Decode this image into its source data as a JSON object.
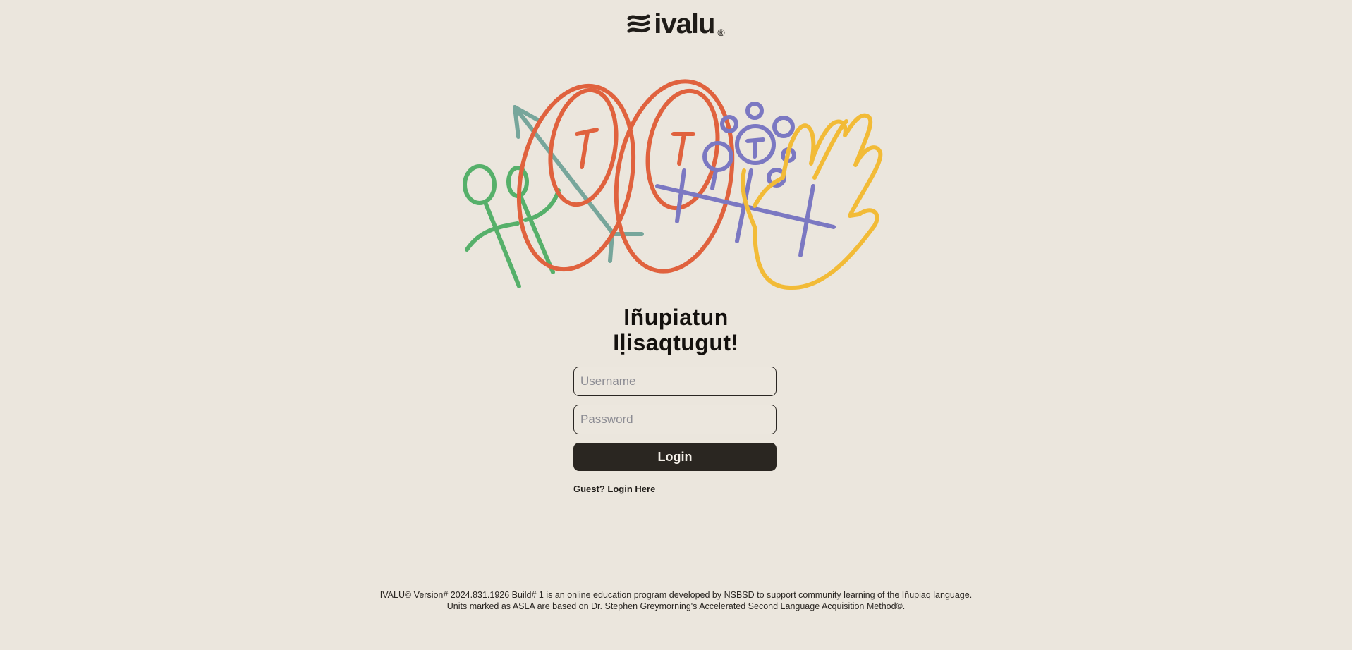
{
  "brand": {
    "name": "ivalu",
    "mark": "®"
  },
  "heading": {
    "line1": "Iñupiatun",
    "line2": "Iḷisaqtugut!"
  },
  "form": {
    "username_placeholder": "Username",
    "password_placeholder": "Password",
    "login_label": "Login"
  },
  "guest": {
    "prompt": "Guest?",
    "link_label": "Login Here"
  },
  "footer": {
    "line1": "IVALU© Version# 2024.831.1926 Build# 1 is an online education program developed by NSBSD to support community learning of the Iñupiaq language.",
    "line2": "Units marked as ASLA are based on Dr. Stephen Greymorning's Accelerated Second Language Acquisition Method©."
  },
  "colors": {
    "background": "#ebe6dd",
    "button": "#2a2621",
    "orange": "#e0623e",
    "green": "#56b06a",
    "teal": "#77a69b",
    "purple": "#7b78c2",
    "yellow": "#f2bb37"
  },
  "icons": [
    "ivalu-logo-mark",
    "hero-illustration"
  ]
}
